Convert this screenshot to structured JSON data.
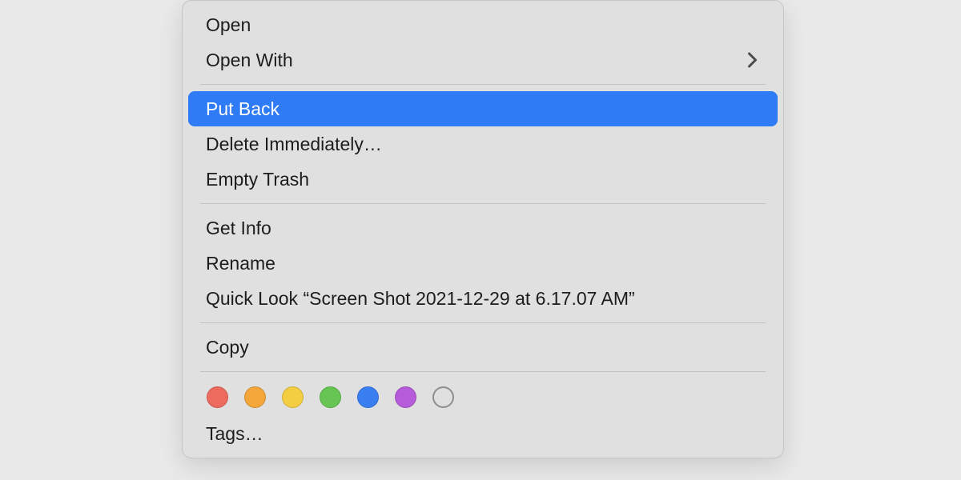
{
  "menu": {
    "open": "Open",
    "open_with": "Open With",
    "put_back": "Put Back",
    "delete_immediately": "Delete Immediately…",
    "empty_trash": "Empty Trash",
    "get_info": "Get Info",
    "rename": "Rename",
    "quick_look": "Quick Look “Screen Shot 2021-12-29 at 6.17.07 AM”",
    "copy": "Copy",
    "tags": "Tags…"
  },
  "tags": {
    "colors": {
      "red": "#ed6a5e",
      "orange": "#f4a63a",
      "yellow": "#f4ce42",
      "green": "#67c653",
      "blue": "#3a7ff2",
      "purple": "#b65bd9"
    }
  },
  "state": {
    "highlighted": "put_back"
  }
}
